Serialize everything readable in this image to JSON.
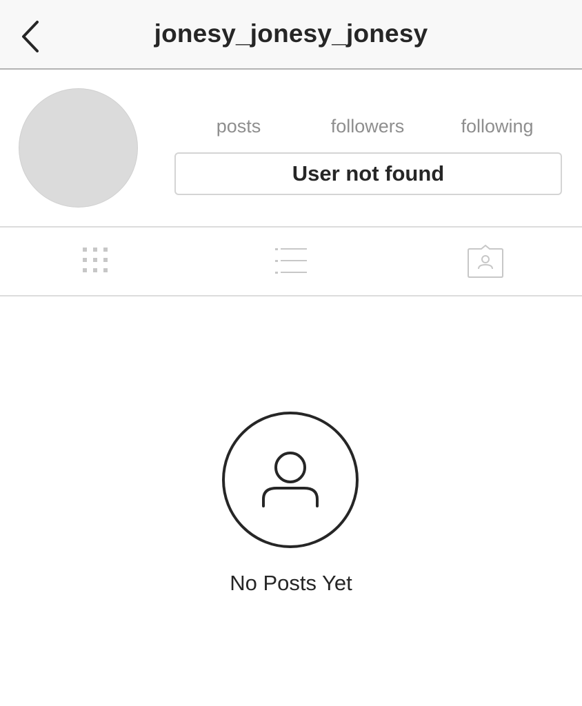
{
  "header": {
    "username": "jonesy_jonesy_jonesy",
    "back_icon": "chevron-left-icon"
  },
  "profile": {
    "avatar_color": "#dbdbdb",
    "stats": {
      "posts_label": "posts",
      "followers_label": "followers",
      "following_label": "following"
    },
    "status_button_label": "User not found"
  },
  "tabs": [
    {
      "name": "grid",
      "icon": "grid-icon"
    },
    {
      "name": "list",
      "icon": "list-icon"
    },
    {
      "name": "tagged",
      "icon": "tagged-photos-icon"
    }
  ],
  "empty_state": {
    "icon": "user-outline-icon",
    "message": "No Posts Yet"
  },
  "colors": {
    "text_primary": "#262626",
    "text_secondary": "#8e8e8e",
    "icon_inactive": "#c7c7c7",
    "divider": "#dcdcdc",
    "header_bg": "#f8f8f8"
  }
}
